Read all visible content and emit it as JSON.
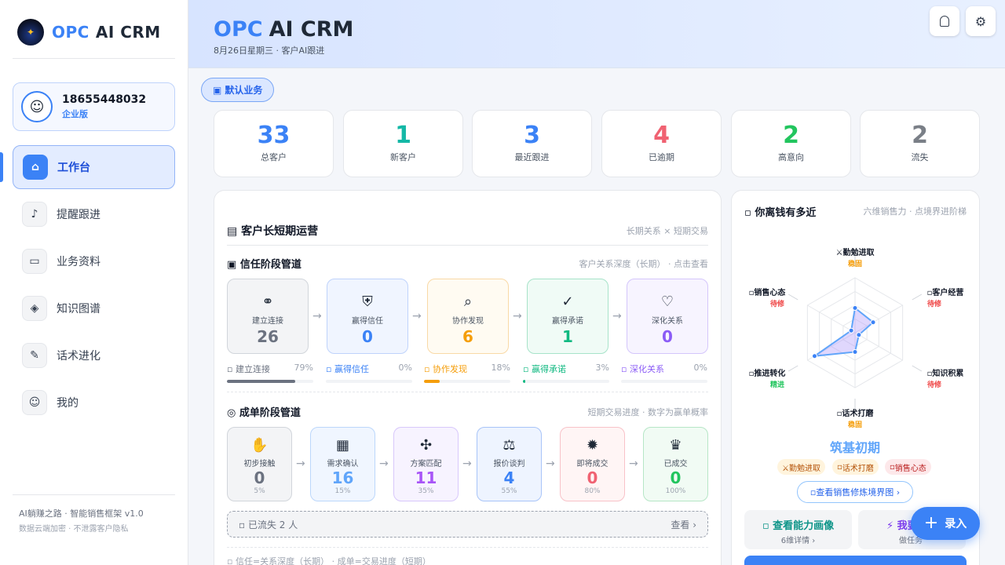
{
  "brand": {
    "opc": "OPC",
    "name": "AI CRM"
  },
  "user": {
    "phone": "18655448032",
    "plan": "企业版",
    "avatar_icon": "user-icon"
  },
  "nav": [
    {
      "label": "工作台",
      "icon": "home-icon",
      "active": true
    },
    {
      "label": "提醒跟进",
      "icon": "bell-icon"
    },
    {
      "label": "业务资料",
      "icon": "folder-icon"
    },
    {
      "label": "知识图谱",
      "icon": "graph-icon"
    },
    {
      "label": "话术进化",
      "icon": "chat-icon"
    },
    {
      "label": "我的",
      "icon": "user-icon"
    }
  ],
  "footer": {
    "line1": "AI躺赚之路 · 智能销售框架 v1.0",
    "line2": "数据云端加密 · 不泄露客户隐私"
  },
  "header": {
    "opc": "OPC",
    "name": "AI CRM",
    "subtitle": "8月26日星期三 · 客户AI跟进",
    "btn1_icon": "notification-icon",
    "btn2_glyph": "⚙",
    "btn2_icon": "gear-icon"
  },
  "business_tag": {
    "icon": "briefcase-icon",
    "label": "默认业务"
  },
  "stats": [
    {
      "value": "33",
      "label": "总客户",
      "color": "#3b82f6"
    },
    {
      "value": "1",
      "label": "新客户",
      "color": "#14b8a6"
    },
    {
      "value": "3",
      "label": "最近跟进",
      "color": "#3b82f6"
    },
    {
      "value": "4",
      "label": "已逾期",
      "color": "#f06272"
    },
    {
      "value": "2",
      "label": "高意向",
      "color": "#22c55e"
    },
    {
      "value": "2",
      "label": "流失",
      "color": "#7a7f87"
    }
  ],
  "ops": {
    "title": "客户长短期运营",
    "title_icon": "chart-icon",
    "note": "长期关系 × 短期交易",
    "trust": {
      "title": "信任阶段管道",
      "title_icon": "handshake-icon",
      "note": "客户关系深度（长期） · 点击查看",
      "stages": [
        {
          "name": "建立连接",
          "count": "26",
          "pct": "79%",
          "value": 79,
          "color": "#6b7280",
          "bg": "#f3f4f6",
          "border": "#d1d5db"
        },
        {
          "name": "赢得信任",
          "count": "0",
          "pct": "0%",
          "value": 0,
          "color": "#3b82f6",
          "bg": "#f0f5ff",
          "border": "#bfd3fb"
        },
        {
          "name": "协作发现",
          "count": "6",
          "pct": "18%",
          "value": 18,
          "color": "#f59e0b",
          "bg": "#fffbf2",
          "border": "#f9d9a6"
        },
        {
          "name": "赢得承诺",
          "count": "1",
          "pct": "3%",
          "value": 3,
          "color": "#10b981",
          "bg": "#f0fbf6",
          "border": "#a7e3c9"
        },
        {
          "name": "深化关系",
          "count": "0",
          "pct": "0%",
          "value": 0,
          "color": "#8b5cf6",
          "bg": "#f7f4ff",
          "border": "#d4c6fb"
        }
      ]
    },
    "deal": {
      "title": "成单阶段管道",
      "title_icon": "target-icon",
      "note": "短期交易进度 · 数字为赢单概率",
      "stages": [
        {
          "name": "初步接触",
          "count": "0",
          "prob": "5%",
          "color": "#6b7280",
          "bg": "#f3f4f6",
          "border": "#d1d5db"
        },
        {
          "name": "需求确认",
          "count": "16",
          "prob": "15%",
          "color": "#60a5fa",
          "bg": "#f0f6ff",
          "border": "#bcd7fb"
        },
        {
          "name": "方案匹配",
          "count": "11",
          "prob": "35%",
          "color": "#a855f7",
          "bg": "#f7f3ff",
          "border": "#d8c8fb"
        },
        {
          "name": "报价谈判",
          "count": "4",
          "prob": "55%",
          "color": "#3b82f6",
          "bg": "#eef4ff",
          "border": "#a8c4f8"
        },
        {
          "name": "即将成交",
          "count": "0",
          "prob": "80%",
          "color": "#f06272",
          "bg": "#fff5f5",
          "border": "#f8c2c8"
        },
        {
          "name": "已成交",
          "count": "0",
          "prob": "100%",
          "color": "#22c55e",
          "bg": "#f1fbf4",
          "border": "#b6e6c6"
        }
      ]
    },
    "lost": {
      "label": "已流失 2 人",
      "icon": "archive-icon",
      "action": "查看 ›"
    },
    "legend": "信任=关系深度（长期） · 成单=交易进度（短期）"
  },
  "money": {
    "title": "你离钱有多近",
    "title_icon": "money-icon",
    "note": "六维销售力 · 点境界进阶梯",
    "dims": [
      {
        "name": "⚔勤勉进取",
        "status": "稳固",
        "status_color": "#f59e0b",
        "value": 0.45
      },
      {
        "name": "客户经营",
        "status": "待修",
        "status_color": "#ef4444",
        "value": 0.38
      },
      {
        "name": "知识积累",
        "status": "待修",
        "status_color": "#ef4444",
        "value": 0.08
      },
      {
        "name": "话术打磨",
        "status": "稳固",
        "status_color": "#f59e0b",
        "value": 0.35
      },
      {
        "name": "推进转化",
        "status": "精进",
        "status_color": "#22c55e",
        "value": 0.85
      },
      {
        "name": "销售心态",
        "status": "待修",
        "status_color": "#ef4444",
        "value": 0.08
      }
    ],
    "realm": "筑基初期",
    "chips": [
      {
        "label": "⚔勤勉进取",
        "bg": "#fff4dd",
        "color": "#b45309"
      },
      {
        "label": "话术打磨",
        "bg": "#fff4dd",
        "color": "#b45309"
      },
      {
        "label": "销售心态",
        "bg": "#fde8ea",
        "color": "#b91c1c"
      }
    ],
    "realm_link": "查看销售修炼境界图 ›",
    "ability": {
      "title": "查看能力画像",
      "sub": "6维详情 ›"
    },
    "task": {
      "title": "⚡ 我要",
      "sub": "做任务"
    }
  },
  "fab": {
    "label": "录入"
  }
}
